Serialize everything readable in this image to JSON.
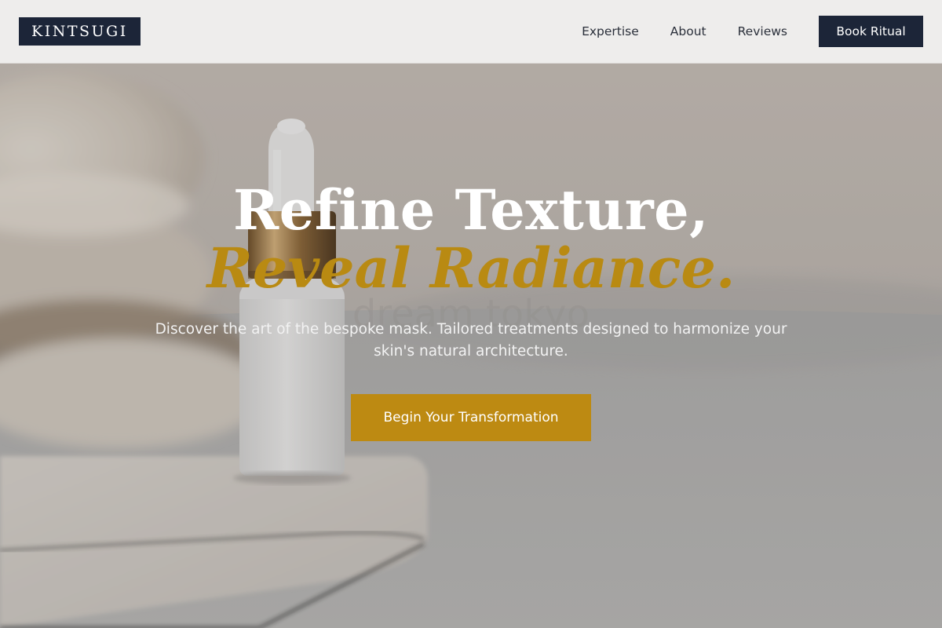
{
  "header": {
    "logo": "KINTSUGI",
    "nav": [
      {
        "label": "Expertise"
      },
      {
        "label": "About"
      },
      {
        "label": "Reviews"
      }
    ],
    "book_label": "Book Ritual"
  },
  "hero": {
    "title_line1": "Refine Texture,",
    "title_line2": "Reveal Radiance.",
    "subtitle": "Discover the art of the bespoke mask. Tailored treatments designed to harmonize your skin's natural architecture.",
    "cta_label": "Begin Your Transformation",
    "image_watermark": "dream tokyo"
  },
  "colors": {
    "navy": "#1c2538",
    "gold": "#bd8a12",
    "header_bg": "#eeedec"
  }
}
